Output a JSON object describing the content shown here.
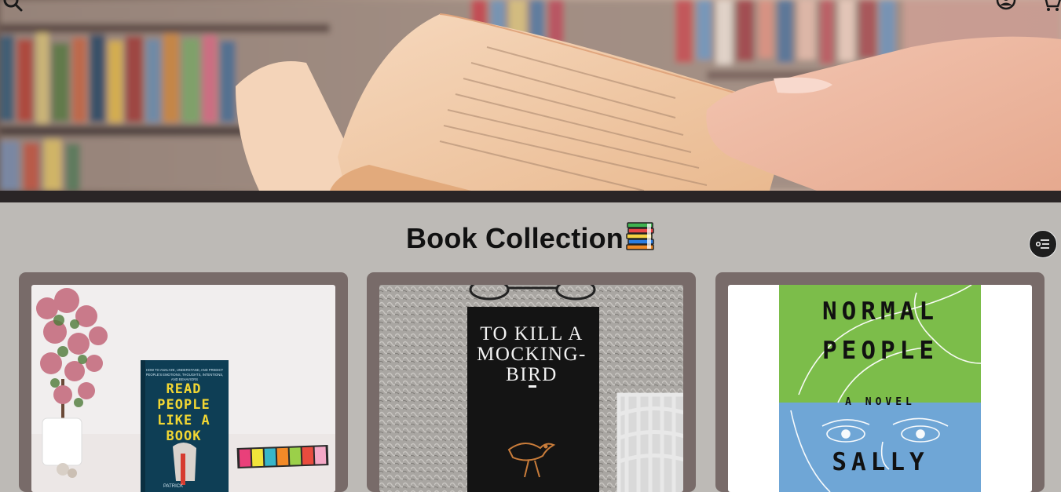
{
  "header": {
    "search_icon": "search-icon",
    "account_icon": "user-icon",
    "cart_icon": "cart-icon"
  },
  "collection": {
    "title": "Book Collection",
    "title_emoji": "books-emoji",
    "filter_icon": "filter-icon"
  },
  "books": [
    {
      "cover_lines": [
        "READ",
        "PEOPLE",
        "LIKE A",
        "BOOK"
      ],
      "author_fragment": "PATRICK",
      "small_text": "HOW TO ANALYZE, UNDERSTAND, AND PREDICT PEOPLE'S EMOTIONS, THOUGHTS, INTENTIONS, AND BEHAVIORS"
    },
    {
      "cover_lines": [
        "TO KILL A",
        "MOCKING-",
        "BIRD"
      ]
    },
    {
      "cover_lines": [
        "NORMAL",
        "PEOPLE"
      ],
      "subtitle": "A NOVEL",
      "author_fragment": "SALLY"
    }
  ]
}
